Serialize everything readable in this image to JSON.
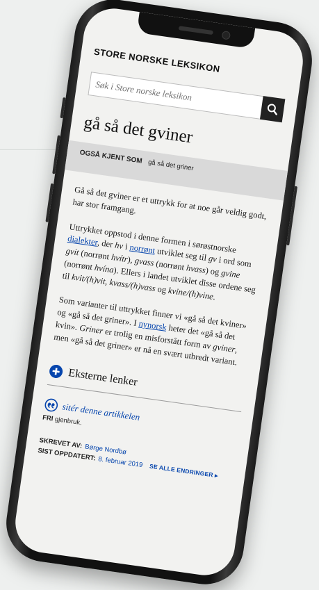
{
  "site": {
    "brand": "STORE NORSKE LEKSIKON"
  },
  "search": {
    "placeholder": "Søk i Store norske leksikon"
  },
  "article": {
    "title": "gå så det gviner",
    "aka_label": "OGSÅ KJENT SOM",
    "aka_value": "gå så det griner",
    "p1": "Gå så det gviner er et uttrykk for at noe går veldig godt, har stor framgang.",
    "p2_a": "Uttrykket oppstod i denne formen i sørøstnorske ",
    "p2_link1": "dialekter",
    "p2_b": ", der ",
    "p2_hv": "hv",
    "p2_c": " i ",
    "p2_link2": "norrønt",
    "p2_d": " utviklet seg til ",
    "p2_gv": "gv",
    "p2_e": " i ord som ",
    "p2_gvit": "gvit",
    "p2_f": " (norrønt ",
    "p2_hvitr": "hvítr",
    "p2_g": "), ",
    "p2_gvass": "gvass",
    "p2_h": " (norrønt ",
    "p2_hvass": "hvass",
    "p2_i": ") og ",
    "p2_gvine": "gvine",
    "p2_j": " (norrønt ",
    "p2_hvina": "hvína",
    "p2_k": "). Ellers i landet utviklet disse ordene seg til ",
    "p2_kvit": "kvit/(h)vit, kvass/(h)vass",
    "p2_l": " og ",
    "p2_kvine": "kvine/(h)vine",
    "p2_m": ".",
    "p3_a": "Som varianter til uttrykket finner vi «gå så det kviner» og «gå så det griner». I ",
    "p3_link": "nynorsk",
    "p3_b": " heter det «gå så det kvin». ",
    "p3_griner": "Griner",
    "p3_c": " er trolig en misforstått form av ",
    "p3_gviner": "gviner",
    "p3_d": ", men «gå så det griner» er nå en svært utbredt variant."
  },
  "external": {
    "label": "Eksterne lenker",
    "icon": "plus-circle-icon"
  },
  "cite": {
    "link": "sitér denne artikkelen",
    "icon": "quote-icon",
    "reuse_bold": "FRI",
    "reuse_rest": " gjenbruk."
  },
  "meta": {
    "author_label": "SKREVET AV:",
    "author": "Børge Nordbø",
    "updated_label": "SIST OPPDATERT:",
    "updated": "8. februar 2019",
    "changes_link": "SE ALLE ENDRINGER ▸"
  },
  "colors": {
    "link": "#0645ad",
    "band": "#d9d9d9",
    "bezel": "#111111"
  }
}
